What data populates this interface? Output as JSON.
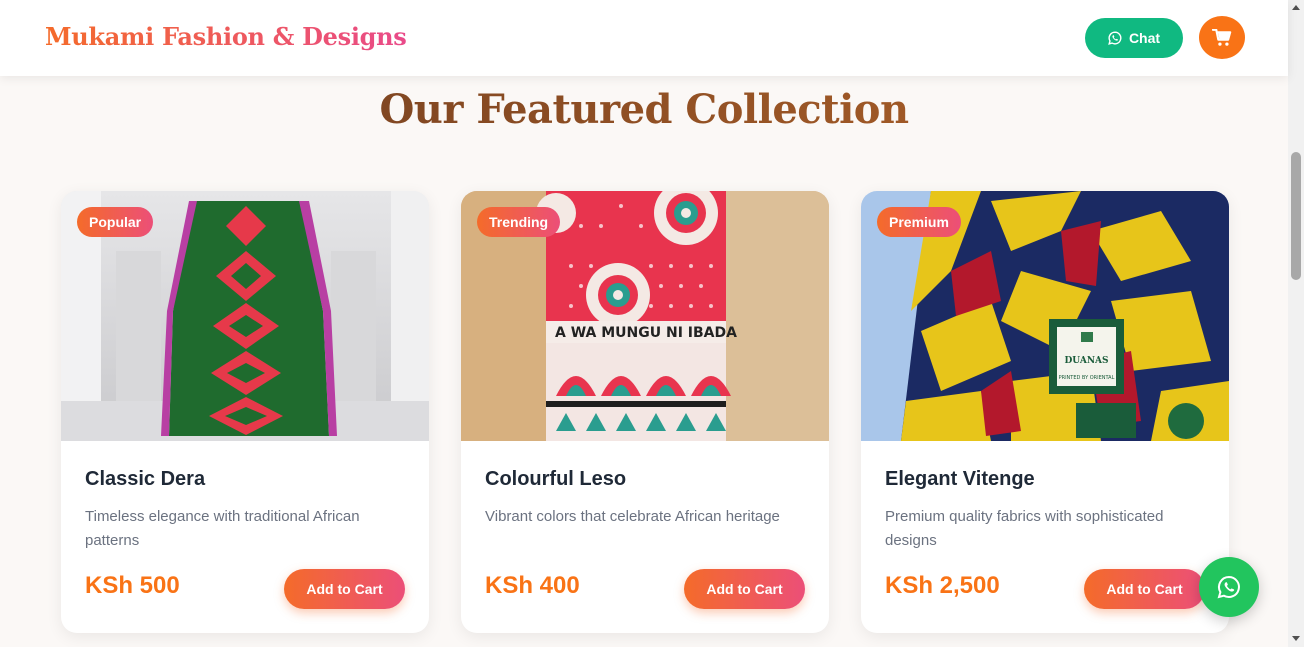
{
  "header": {
    "brand": "Mukami Fashion & Designs",
    "chat_label": "Chat",
    "chat_icon": "whatsapp-icon",
    "cart_icon": "cart-icon"
  },
  "section": {
    "title": "Our Featured Collection"
  },
  "products": [
    {
      "badge": "Popular",
      "title": "Classic Dera",
      "description": "Timeless elegance with traditional African patterns",
      "price": "KSh 500",
      "button": "Add to Cart"
    },
    {
      "badge": "Trending",
      "title": "Colourful Leso",
      "description": "Vibrant colors that celebrate African heritage",
      "price": "KSh 400",
      "button": "Add to Cart",
      "fabric_text": "A WA MUNGU NI IBADA"
    },
    {
      "badge": "Premium",
      "title": "Elegant Vitenge",
      "description": "Premium quality fabrics with sophisticated designs",
      "price": "KSh 2,500",
      "button": "Add to Cart",
      "label_text": "DUANAS",
      "label_subtext": "PRINTED BY ORIENTAL"
    }
  ],
  "colors": {
    "accent": "#f97316",
    "accent_pink": "#ec4f78",
    "chat_green": "#10b981",
    "whatsapp_green": "#22c55e"
  }
}
